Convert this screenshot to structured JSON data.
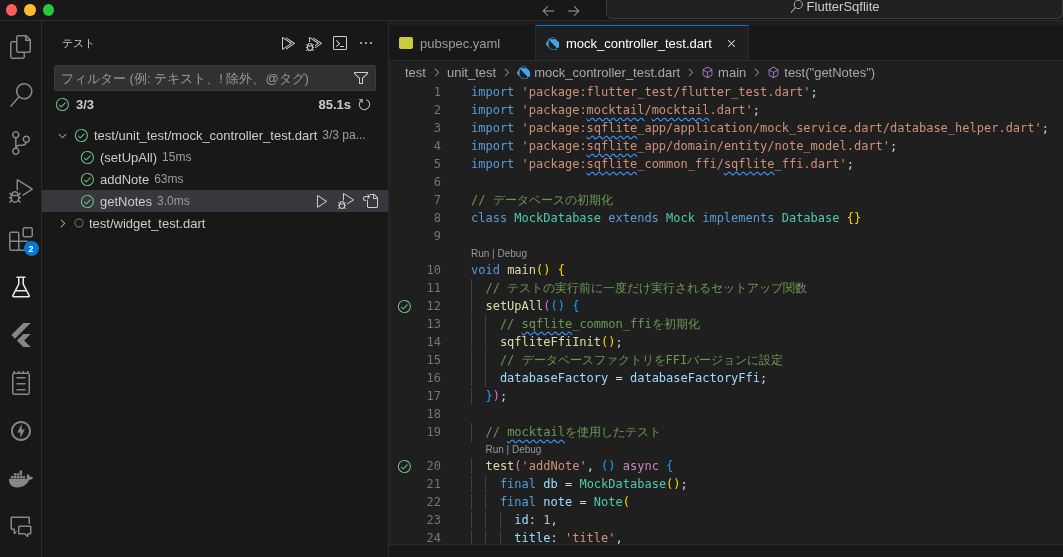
{
  "titlebar": {
    "search": "FlutterSqflite"
  },
  "activity_bar": [
    {
      "kind": "files",
      "selected": false
    },
    {
      "kind": "search",
      "selected": false
    },
    {
      "kind": "branch",
      "selected": false
    },
    {
      "kind": "debug",
      "selected": false
    },
    {
      "kind": "extensions",
      "selected": false,
      "badge": "2"
    },
    {
      "kind": "flask",
      "selected": true
    },
    {
      "kind": "chevron",
      "selected": false
    },
    {
      "kind": "list",
      "selected": false
    },
    {
      "kind": "bolt",
      "selected": false
    },
    {
      "kind": "whale",
      "selected": false
    },
    {
      "kind": "chat",
      "selected": false
    }
  ],
  "sidebar": {
    "title": "テスト",
    "filter": {
      "placeholder": "フィルター (例: テキスト、! 除外、@タグ)"
    },
    "summary": {
      "count": "3/3",
      "time": "85.1s"
    },
    "tree": [
      {
        "label": "test/unit_test/mock_controller_test.dart",
        "detail": "3/3 pa...",
        "passed": true,
        "expanded": true,
        "selected": false,
        "children": [
          {
            "label": "(setUpAll)",
            "detail": "15ms",
            "passed": true,
            "selected": false
          },
          {
            "label": "addNote",
            "detail": "63ms",
            "passed": true,
            "selected": false
          },
          {
            "label": "getNotes",
            "detail": "3.0ms",
            "passed": true,
            "selected": true
          }
        ]
      },
      {
        "label": "test/widget_test.dart",
        "passed": false,
        "expanded": false,
        "selected": false
      }
    ]
  },
  "tabs": [
    {
      "label": "pubspec.yaml",
      "kind": "yaml",
      "selected": false
    },
    {
      "label": "mock_controller_test.dart",
      "kind": "dart",
      "selected": true
    }
  ],
  "breadcrumb": [
    {
      "label": "test",
      "kind": "folder"
    },
    {
      "label": "unit_test",
      "kind": "folder"
    },
    {
      "label": "mock_controller_test.dart",
      "kind": "dart"
    },
    {
      "label": "main",
      "kind": "symbol"
    },
    {
      "label": "test(\"getNotes\")",
      "kind": "symbol"
    }
  ],
  "code": [
    {
      "n": "1",
      "tokens": [
        {
          "t": "import",
          "kind": "kw"
        },
        {
          "t": " 'package:flutter_test/flutter_test.dart'",
          "kind": "str"
        },
        {
          "t": ";",
          "kind": "p"
        }
      ]
    },
    {
      "n": "2",
      "tokens": [
        {
          "t": "import",
          "kind": "kw"
        },
        {
          "t": " 'package:",
          "kind": "str"
        },
        {
          "t": "mocktail",
          "kind": "str",
          "squiggle": true
        },
        {
          "t": "/",
          "kind": "str"
        },
        {
          "t": "mocktail",
          "kind": "str",
          "squiggle": true
        },
        {
          "t": ".dart'",
          "kind": "str"
        },
        {
          "t": ";",
          "kind": "p"
        }
      ]
    },
    {
      "n": "3",
      "tokens": [
        {
          "t": "import",
          "kind": "kw"
        },
        {
          "t": " 'package:",
          "kind": "str"
        },
        {
          "t": "sqflite",
          "kind": "str",
          "squiggle": true
        },
        {
          "t": "_app/application/mock_service.dart/database_helper.dart'",
          "kind": "str"
        },
        {
          "t": ";",
          "kind": "p"
        }
      ]
    },
    {
      "n": "4",
      "tokens": [
        {
          "t": "import",
          "kind": "kw"
        },
        {
          "t": " 'package:",
          "kind": "str"
        },
        {
          "t": "sqflite",
          "kind": "str",
          "squiggle": true
        },
        {
          "t": "_app/domain/entity/note_model.dart'",
          "kind": "str"
        },
        {
          "t": ";",
          "kind": "p"
        }
      ]
    },
    {
      "n": "5",
      "tokens": [
        {
          "t": "import",
          "kind": "kw"
        },
        {
          "t": " 'package:",
          "kind": "str"
        },
        {
          "t": "sqflite",
          "kind": "str",
          "squiggle": true
        },
        {
          "t": "_common_ffi/",
          "kind": "str"
        },
        {
          "t": "sqflite",
          "kind": "str",
          "squiggle": true
        },
        {
          "t": "_ffi.dart'",
          "kind": "str"
        },
        {
          "t": ";",
          "kind": "p"
        }
      ]
    },
    {
      "n": "6"
    },
    {
      "n": "7",
      "tokens": [
        {
          "t": "// データベースの初期化",
          "kind": "cm"
        }
      ]
    },
    {
      "n": "8",
      "tokens": [
        {
          "t": "class",
          "kind": "kw"
        },
        {
          "t": " MockDatabase",
          "kind": "type"
        },
        {
          "t": " extends",
          "kind": "kw"
        },
        {
          "t": " Mock",
          "kind": "type"
        },
        {
          "t": " implements",
          "kind": "kw"
        },
        {
          "t": " Database",
          "kind": "type"
        },
        {
          "t": " {}",
          "kind": "b1"
        }
      ]
    },
    {
      "n": "9"
    },
    {
      "n": "10",
      "lens": "Run | Debug",
      "tokens": [
        {
          "t": "void",
          "kind": "kw"
        },
        {
          "t": " main",
          "kind": "fn"
        },
        {
          "t": "() {",
          "kind": "b1"
        }
      ]
    },
    {
      "n": "11",
      "tokens": [
        {
          "t": "  // テストの実行前に一度だけ実行されるセットアップ関数",
          "kind": "cm"
        }
      ]
    },
    {
      "n": "12",
      "passed": true,
      "tokens": [
        {
          "t": "  setUpAll",
          "kind": "fn"
        },
        {
          "t": "(",
          "kind": "b2"
        },
        {
          "t": "() {",
          "kind": "b3"
        }
      ]
    },
    {
      "n": "13",
      "tokens": [
        {
          "t": "    // ",
          "kind": "cm"
        },
        {
          "t": "sqflite",
          "kind": "cm",
          "squiggle": true
        },
        {
          "t": "_common_ffiを初期化",
          "kind": "cm"
        }
      ]
    },
    {
      "n": "14",
      "tokens": [
        {
          "t": "    sqfliteFfiInit",
          "kind": "fn"
        },
        {
          "t": "()",
          "kind": "b1"
        },
        {
          "t": ";",
          "kind": "p"
        }
      ]
    },
    {
      "n": "15",
      "tokens": [
        {
          "t": "    // データベースファクトリをFFIバージョンに設定",
          "kind": "cm"
        }
      ]
    },
    {
      "n": "16",
      "tokens": [
        {
          "t": "    databaseFactory",
          "kind": "var"
        },
        {
          "t": " = ",
          "kind": "p"
        },
        {
          "t": "databaseFactoryFfi",
          "kind": "var"
        },
        {
          "t": ";",
          "kind": "p"
        }
      ]
    },
    {
      "n": "17",
      "tokens": [
        {
          "t": "  }",
          "kind": "b3"
        },
        {
          "t": ")",
          "kind": "b2"
        },
        {
          "t": ";",
          "kind": "p"
        }
      ]
    },
    {
      "n": "18"
    },
    {
      "n": "19",
      "tokens": [
        {
          "t": "  // ",
          "kind": "cm"
        },
        {
          "t": "mocktail",
          "kind": "cm",
          "squiggle": true
        },
        {
          "t": "を使用したテスト",
          "kind": "cm"
        }
      ]
    },
    {
      "n": "20",
      "passed": true,
      "lens": "Run | Debug",
      "tokens": [
        {
          "t": "  test",
          "kind": "fn"
        },
        {
          "t": "(",
          "kind": "b2"
        },
        {
          "t": "'addNote'",
          "kind": "str"
        },
        {
          "t": ", ",
          "kind": "p"
        },
        {
          "t": "()",
          "kind": "b3"
        },
        {
          "t": " async",
          "kind": "ctl"
        },
        {
          "t": " {",
          "kind": "b3"
        }
      ]
    },
    {
      "n": "21",
      "tokens": [
        {
          "t": "    final",
          "kind": "kw"
        },
        {
          "t": " db",
          "kind": "var"
        },
        {
          "t": " = ",
          "kind": "p"
        },
        {
          "t": "MockDatabase",
          "kind": "type"
        },
        {
          "t": "()",
          "kind": "b1"
        },
        {
          "t": ";",
          "kind": "p"
        }
      ]
    },
    {
      "n": "22",
      "tokens": [
        {
          "t": "    final",
          "kind": "kw"
        },
        {
          "t": " note",
          "kind": "var"
        },
        {
          "t": " = ",
          "kind": "p"
        },
        {
          "t": "Note",
          "kind": "type"
        },
        {
          "t": "(",
          "kind": "b1"
        }
      ]
    },
    {
      "n": "23",
      "tokens": [
        {
          "t": "      id",
          "kind": "var"
        },
        {
          "t": ": ",
          "kind": "p"
        },
        {
          "t": "1",
          "kind": "num"
        },
        {
          "t": ",",
          "kind": "p"
        }
      ]
    },
    {
      "n": "24",
      "tokens": [
        {
          "t": "      title",
          "kind": "var"
        },
        {
          "t": ": ",
          "kind": "p"
        },
        {
          "t": "'title'",
          "kind": "str"
        },
        {
          "t": ",",
          "kind": "p"
        }
      ]
    }
  ]
}
